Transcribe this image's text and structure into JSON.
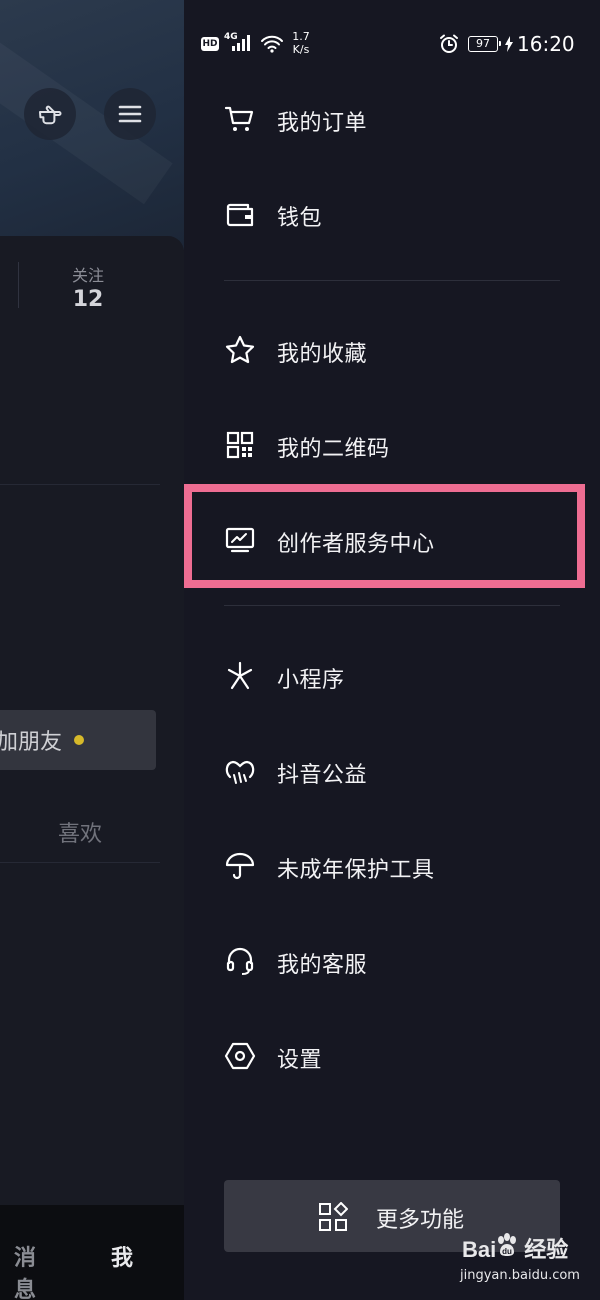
{
  "status_bar": {
    "hd": "HD",
    "network": "4G",
    "speed_value": "1.7",
    "speed_unit": "K/s",
    "battery": "97",
    "time": "16:20"
  },
  "background_page": {
    "follow_label": "关注",
    "follow_count": "12",
    "add_friend_label": "加朋友",
    "likes_tab": "喜欢",
    "tab_messages": "消息",
    "tab_me": "我",
    "icons": [
      "pointing-hand-icon",
      "menu-icon"
    ]
  },
  "drawer": {
    "items": [
      {
        "label": "我的订单",
        "icon": "cart-icon"
      },
      {
        "label": "钱包",
        "icon": "wallet-icon"
      },
      {
        "label": "我的收藏",
        "icon": "star-icon"
      },
      {
        "label": "我的二维码",
        "icon": "qrcode-icon"
      },
      {
        "label": "创作者服务中心",
        "icon": "creator-monitor-icon"
      },
      {
        "label": "小程序",
        "icon": "mini-program-icon"
      },
      {
        "label": "抖音公益",
        "icon": "charity-heart-icon"
      },
      {
        "label": "未成年保护工具",
        "icon": "umbrella-icon"
      },
      {
        "label": "我的客服",
        "icon": "headset-icon"
      },
      {
        "label": "设置",
        "icon": "settings-hexagon-icon"
      }
    ],
    "more_button": {
      "label": "更多功能",
      "icon": "grid-more-icon"
    },
    "highlight_color": "#ee6d92"
  },
  "watermark": {
    "brand_left": "Bai",
    "brand_right": "经验",
    "url": "jingyan.baidu.com"
  }
}
